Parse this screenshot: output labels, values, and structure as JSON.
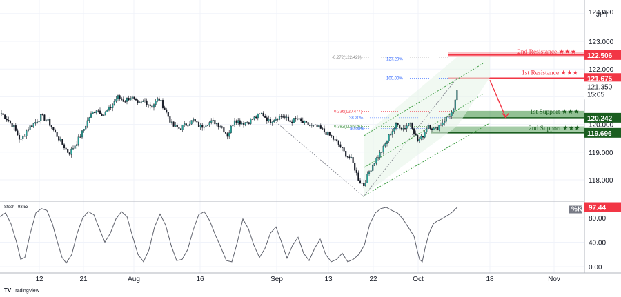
{
  "chart_data": [
    {
      "type": "candlestick",
      "symbol_unit": "JPY",
      "price_axis": {
        "ticks": [
          118.0,
          119.0,
          120.0,
          122.0,
          123.0
        ],
        "ticks_labels": [
          "118.000",
          "119.000",
          "120.000",
          "122.000",
          "123.000"
        ],
        "top_partial_label": "124.000",
        "range": [
          117.3,
          124.1
        ]
      },
      "time_axis": {
        "labels": [
          "12",
          "21",
          "Aug",
          "16",
          "Sep",
          "13",
          "22",
          "Oct",
          "18",
          "Nov"
        ]
      },
      "current_price": 121.35,
      "current_price_label": "121.350",
      "countdown": "15:05",
      "levels": [
        {
          "name": "2nd Resistance",
          "label": "2nd Resistance ★★★",
          "value": 122.506,
          "value_label": "122.506",
          "color": "#f23645"
        },
        {
          "name": "1st Resistance",
          "label": "1st Resistance ★★★",
          "value": 121.675,
          "value_label": "121.675",
          "color": "#f23645"
        },
        {
          "name": "1st Support",
          "label": "1st Support ★★★",
          "value": 120.242,
          "value_label": "120.242",
          "color": "#388e3c"
        },
        {
          "name": "2nd Support",
          "label": "2nd Support ★★★",
          "value": 119.696,
          "value_label": "119.696",
          "color": "#388e3c"
        }
      ],
      "fib_labels": [
        {
          "text": "-0.272(122.429)",
          "value": 122.429,
          "color": "#888888"
        },
        {
          "text": "127.20%",
          "value": 122.429,
          "color": "#2962ff"
        },
        {
          "text": "100.00%",
          "value": 121.675,
          "color": "#2962ff"
        },
        {
          "text": "0.236(120.477)",
          "value": 120.477,
          "color": "#f23645"
        },
        {
          "text": "38.20%",
          "value": 120.242,
          "color": "#2962ff"
        },
        {
          "text": "0.382(119.926)",
          "value": 119.926,
          "color": "#388e3c"
        },
        {
          "text": "50.00%",
          "value": 119.85,
          "color": "#2962ff"
        }
      ],
      "price_path": [
        [
          0,
          120.45
        ],
        [
          10,
          120.2
        ],
        [
          20,
          119.9
        ],
        [
          30,
          119.4
        ],
        [
          40,
          119.85
        ],
        [
          50,
          120.05
        ],
        [
          60,
          120.3
        ],
        [
          70,
          120.1
        ],
        [
          80,
          119.7
        ],
        [
          90,
          119.3
        ],
        [
          100,
          118.95
        ],
        [
          110,
          119.3
        ],
        [
          120,
          119.75
        ],
        [
          130,
          120.3
        ],
        [
          140,
          120.55
        ],
        [
          150,
          120.35
        ],
        [
          160,
          120.6
        ],
        [
          170,
          121.0
        ],
        [
          180,
          120.85
        ],
        [
          190,
          121.0
        ],
        [
          200,
          120.7
        ],
        [
          210,
          120.85
        ],
        [
          220,
          120.65
        ],
        [
          230,
          120.95
        ],
        [
          240,
          120.5
        ],
        [
          250,
          119.95
        ],
        [
          260,
          119.85
        ],
        [
          270,
          120.0
        ],
        [
          280,
          120.15
        ],
        [
          290,
          119.9
        ],
        [
          300,
          120.05
        ],
        [
          310,
          120.1
        ],
        [
          320,
          119.95
        ],
        [
          330,
          119.6
        ],
        [
          340,
          120.2
        ],
        [
          350,
          120.05
        ],
        [
          360,
          120.1
        ],
        [
          370,
          120.25
        ],
        [
          380,
          120.4
        ],
        [
          390,
          120.1
        ],
        [
          400,
          120.25
        ],
        [
          410,
          120.3
        ],
        [
          420,
          120.1
        ],
        [
          430,
          120.2
        ],
        [
          440,
          120.05
        ],
        [
          450,
          119.95
        ],
        [
          460,
          119.9
        ],
        [
          470,
          119.75
        ],
        [
          480,
          119.55
        ],
        [
          490,
          119.3
        ],
        [
          500,
          118.95
        ],
        [
          510,
          118.7
        ],
        [
          520,
          118.0
        ],
        [
          527,
          117.8
        ],
        [
          535,
          118.3
        ],
        [
          545,
          118.75
        ],
        [
          555,
          119.1
        ],
        [
          565,
          119.65
        ],
        [
          575,
          120.0
        ],
        [
          585,
          119.85
        ],
        [
          595,
          120.1
        ],
        [
          605,
          119.4
        ],
        [
          612,
          119.55
        ],
        [
          620,
          120.0
        ],
        [
          630,
          119.8
        ],
        [
          640,
          120.05
        ],
        [
          650,
          120.3
        ],
        [
          658,
          120.5
        ],
        [
          663,
          121.35
        ]
      ],
      "channel_upper": [
        [
          528,
          119.6
        ],
        [
          700,
          122.2
        ]
      ],
      "channel_middle": [
        [
          528,
          118.45
        ],
        [
          700,
          121.1
        ]
      ],
      "channel_lower": [
        [
          526,
          117.4
        ],
        [
          710,
          120.05
        ]
      ],
      "fib_zigzag": [
        [
          385,
          120.4
        ],
        [
          527,
          117.4
        ],
        [
          663,
          121.7
        ]
      ],
      "forecast_arrow": {
        "from": [
          710,
          121.6
        ],
        "to": [
          733,
          120.25
        ]
      }
    },
    {
      "type": "line",
      "indicator": "Stoch",
      "title": "Stoch",
      "title_value": "93.53",
      "series_name": "%K",
      "last_value_label": "97.44",
      "overbought_value": 97.44,
      "ticks": [
        0,
        40,
        80
      ],
      "ticks_labels": [
        "0.00",
        "40.00",
        "80.00"
      ],
      "range": [
        -5,
        110
      ],
      "values": [
        [
          0,
          82
        ],
        [
          8,
          88
        ],
        [
          16,
          70
        ],
        [
          24,
          40
        ],
        [
          30,
          12
        ],
        [
          36,
          15
        ],
        [
          44,
          55
        ],
        [
          52,
          88
        ],
        [
          60,
          95
        ],
        [
          68,
          92
        ],
        [
          76,
          70
        ],
        [
          82,
          45
        ],
        [
          90,
          15
        ],
        [
          96,
          6
        ],
        [
          104,
          20
        ],
        [
          112,
          55
        ],
        [
          120,
          80
        ],
        [
          128,
          90
        ],
        [
          136,
          85
        ],
        [
          144,
          62
        ],
        [
          152,
          40
        ],
        [
          160,
          55
        ],
        [
          168,
          78
        ],
        [
          176,
          90
        ],
        [
          184,
          82
        ],
        [
          192,
          50
        ],
        [
          200,
          20
        ],
        [
          208,
          8
        ],
        [
          216,
          28
        ],
        [
          224,
          65
        ],
        [
          232,
          86
        ],
        [
          240,
          68
        ],
        [
          248,
          35
        ],
        [
          256,
          10
        ],
        [
          264,
          12
        ],
        [
          272,
          28
        ],
        [
          280,
          60
        ],
        [
          288,
          85
        ],
        [
          296,
          90
        ],
        [
          304,
          75
        ],
        [
          312,
          52
        ],
        [
          320,
          32
        ],
        [
          328,
          10
        ],
        [
          336,
          8
        ],
        [
          344,
          40
        ],
        [
          352,
          78
        ],
        [
          360,
          62
        ],
        [
          368,
          35
        ],
        [
          376,
          15
        ],
        [
          384,
          30
        ],
        [
          392,
          55
        ],
        [
          400,
          65
        ],
        [
          408,
          40
        ],
        [
          416,
          14
        ],
        [
          424,
          35
        ],
        [
          432,
          48
        ],
        [
          440,
          22
        ],
        [
          448,
          10
        ],
        [
          456,
          30
        ],
        [
          464,
          45
        ],
        [
          472,
          20
        ],
        [
          480,
          8
        ],
        [
          488,
          12
        ],
        [
          496,
          22
        ],
        [
          504,
          8
        ],
        [
          512,
          12
        ],
        [
          520,
          20
        ],
        [
          528,
          35
        ],
        [
          536,
          70
        ],
        [
          544,
          88
        ],
        [
          552,
          95
        ],
        [
          560,
          97
        ],
        [
          568,
          92
        ],
        [
          576,
          88
        ],
        [
          584,
          78
        ],
        [
          592,
          64
        ],
        [
          600,
          50
        ],
        [
          604,
          30
        ],
        [
          608,
          12
        ],
        [
          612,
          8
        ],
        [
          616,
          30
        ],
        [
          622,
          55
        ],
        [
          628,
          70
        ],
        [
          634,
          75
        ],
        [
          640,
          78
        ],
        [
          646,
          82
        ],
        [
          652,
          86
        ],
        [
          658,
          92
        ],
        [
          663,
          97.44
        ]
      ]
    }
  ],
  "brand": "TradingView"
}
